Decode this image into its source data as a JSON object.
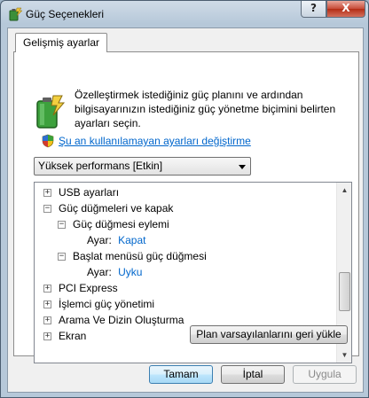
{
  "window": {
    "title": "Güç Seçenekleri",
    "help_label": "?",
    "close_label": "X"
  },
  "tab": {
    "label": "Gelişmiş ayarlar"
  },
  "description": "Özelleştirmek istediğiniz güç planını ve ardından bilgisayarınızın istediğiniz güç yönetme biçimini belirten ayarları seçin.",
  "link": {
    "text": "Şu an kullanılamayan ayarları değiştirme"
  },
  "plan_select": {
    "value": "Yüksek performans [Etkin]"
  },
  "tree": {
    "items": [
      {
        "expander": "+",
        "label": "USB ayarları"
      },
      {
        "expander": "−",
        "label": "Güç düğmeleri ve kapak"
      },
      {
        "expander": "−",
        "label": "Güç düğmesi eylemi"
      },
      {
        "label_prefix": "Ayar:",
        "value": "Kapat"
      },
      {
        "expander": "−",
        "label": "Başlat menüsü güç düğmesi"
      },
      {
        "label_prefix": "Ayar:",
        "value": "Uyku"
      },
      {
        "expander": "+",
        "label": "PCI Express"
      },
      {
        "expander": "+",
        "label": "İşlemci güç yönetimi"
      },
      {
        "expander": "+",
        "label": "Arama Ve Dizin Oluşturma"
      },
      {
        "expander": "+",
        "label": "Ekran"
      }
    ]
  },
  "buttons": {
    "restore": "Plan varsayılanlarını geri yükle",
    "ok": "Tamam",
    "cancel": "İptal",
    "apply": "Uygula"
  },
  "colors": {
    "link": "#0066cc",
    "value": "#0066cc"
  }
}
